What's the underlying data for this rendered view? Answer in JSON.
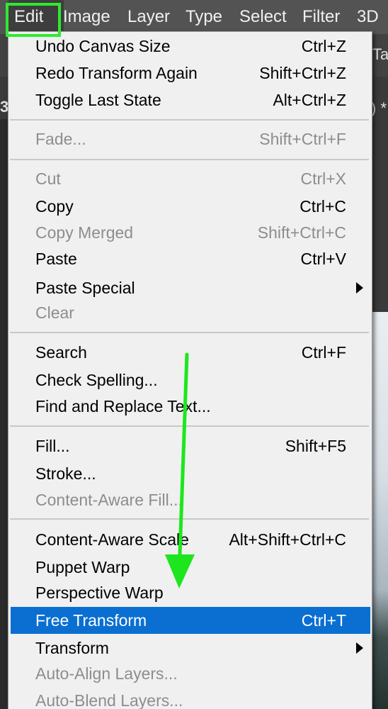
{
  "menubar": {
    "items": [
      "Edit",
      "Image",
      "Layer",
      "Type",
      "Select",
      "Filter",
      "3D"
    ]
  },
  "background": {
    "tab_edge_left": "3",
    "tab_edge_right": ") *",
    "toolbar_edge": "Ta"
  },
  "edit_menu": {
    "items": [
      {
        "label": "Undo Canvas Size",
        "shortcut": "Ctrl+Z",
        "enabled": true
      },
      {
        "label": "Redo Transform Again",
        "shortcut": "Shift+Ctrl+Z",
        "enabled": true
      },
      {
        "label": "Toggle Last State",
        "shortcut": "Alt+Ctrl+Z",
        "enabled": true
      },
      {
        "label": "Fade...",
        "shortcut": "Shift+Ctrl+F",
        "enabled": false
      },
      {
        "label": "Cut",
        "shortcut": "Ctrl+X",
        "enabled": false
      },
      {
        "label": "Copy",
        "shortcut": "Ctrl+C",
        "enabled": true
      },
      {
        "label": "Copy Merged",
        "shortcut": "Shift+Ctrl+C",
        "enabled": false
      },
      {
        "label": "Paste",
        "shortcut": "Ctrl+V",
        "enabled": true
      },
      {
        "label": "Paste Special",
        "shortcut": "",
        "enabled": true,
        "submenu": true
      },
      {
        "label": "Clear",
        "shortcut": "",
        "enabled": false
      },
      {
        "label": "Search",
        "shortcut": "Ctrl+F",
        "enabled": true
      },
      {
        "label": "Check Spelling...",
        "shortcut": "",
        "enabled": true
      },
      {
        "label": "Find and Replace Text...",
        "shortcut": "",
        "enabled": true
      },
      {
        "label": "Fill...",
        "shortcut": "Shift+F5",
        "enabled": true
      },
      {
        "label": "Stroke...",
        "shortcut": "",
        "enabled": true
      },
      {
        "label": "Content-Aware Fill...",
        "shortcut": "",
        "enabled": false
      },
      {
        "label": "Content-Aware Scale",
        "shortcut": "Alt+Shift+Ctrl+C",
        "enabled": true
      },
      {
        "label": "Puppet Warp",
        "shortcut": "",
        "enabled": true
      },
      {
        "label": "Perspective Warp",
        "shortcut": "",
        "enabled": true
      },
      {
        "label": "Free Transform",
        "shortcut": "Ctrl+T",
        "enabled": true,
        "selected": true
      },
      {
        "label": "Transform",
        "shortcut": "",
        "enabled": true,
        "submenu": true
      },
      {
        "label": "Auto-Align Layers...",
        "shortcut": "",
        "enabled": false
      },
      {
        "label": "Auto-Blend Layers...",
        "shortcut": "",
        "enabled": false
      }
    ]
  },
  "annotation": {
    "highlight_color": "#2eea2e",
    "arrow_color": "#1ee61e"
  },
  "colors": {
    "menu_bg": "#f0f0f0",
    "selection": "#0a6fd1",
    "disabled_text": "#8d8d8d",
    "menubar_bg": "#535353"
  }
}
